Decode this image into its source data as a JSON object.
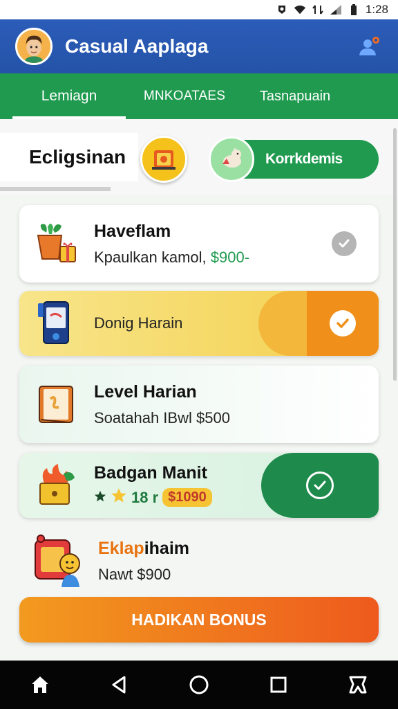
{
  "status_bar": {
    "time": "1:28"
  },
  "app_bar": {
    "title": "Casual Aaplaga"
  },
  "tabs": [
    {
      "label": "Lemiagn",
      "active": true
    },
    {
      "label": "MNKOATAES",
      "active": false
    },
    {
      "label": "Tasnapuain",
      "active": false
    }
  ],
  "section": {
    "title": "Ecligsinan",
    "pill_label": "Korrkdemis"
  },
  "cards": [
    {
      "title": "Haveflam",
      "subtitle": "Kpaulkan kamol,",
      "price": "$900-",
      "status": "done"
    },
    {
      "title": "Donig Harain",
      "status": "checked"
    },
    {
      "title": "Level Harian",
      "subtitle": "Soatahah IBwl $500"
    },
    {
      "title": "Badgan Manit",
      "rating": "18 r",
      "price": "$1090",
      "status": "checked"
    }
  ],
  "list_item": {
    "title_a": "Eklap",
    "title_b": "ihaim",
    "subtitle": "Nawt $900"
  },
  "bonus_button": {
    "label": "HADIKAN BONUS"
  },
  "colors": {
    "app_bar": "#2453a8",
    "tabs": "#1f9a4f",
    "accent_orange": "#f0901a",
    "accent_green": "#1e8a4c"
  },
  "nav": {
    "icons": [
      "home-icon",
      "back-icon",
      "home-circle-icon",
      "recents-icon",
      "accessibility-icon"
    ]
  }
}
